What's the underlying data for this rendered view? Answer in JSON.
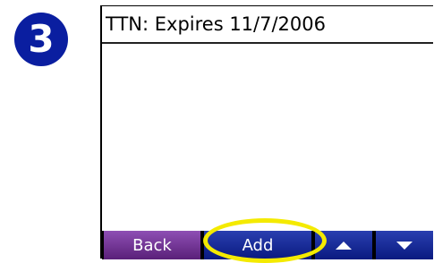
{
  "step": {
    "number": "3",
    "color": "#0a1ea0"
  },
  "screen": {
    "title": "TTN: Expires 11/7/2006"
  },
  "buttons": {
    "back_label": "Back",
    "add_label": "Add",
    "up_icon": "up-arrow-icon",
    "down_icon": "down-arrow-icon"
  },
  "colors": {
    "back_button": "#6d2e94",
    "nav_button": "#13268e",
    "highlight": "#f4ea00"
  }
}
